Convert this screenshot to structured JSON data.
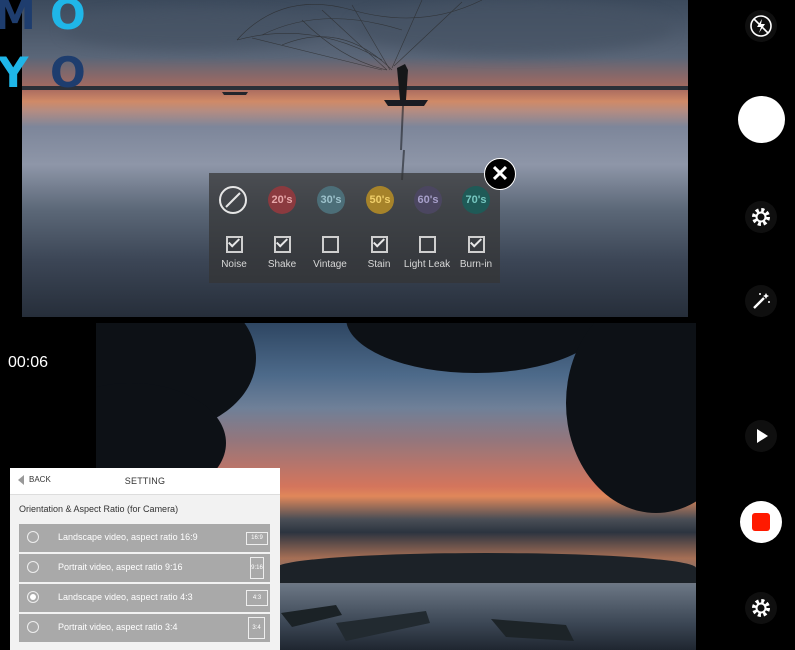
{
  "logo": {
    "letters": [
      "M",
      "O",
      "Y",
      "O"
    ]
  },
  "filters": {
    "eras": [
      {
        "label": "",
        "color": "#d9d9d9",
        "text_color": "#ffffff"
      },
      {
        "label": "20's",
        "color": "#8b3a3f",
        "text_color": "#e7a7a9"
      },
      {
        "label": "30's",
        "color": "#4c6e78",
        "text_color": "#9dc2cc"
      },
      {
        "label": "50's",
        "color": "#a6832a",
        "text_color": "#f0cf6a"
      },
      {
        "label": "60's",
        "color": "#4b4660",
        "text_color": "#a79fca"
      },
      {
        "label": "70's",
        "color": "#1f5a57",
        "text_color": "#76c7c0"
      }
    ],
    "checks": [
      {
        "label": "Noise",
        "checked": true
      },
      {
        "label": "Shake",
        "checked": true
      },
      {
        "label": "Vintage",
        "checked": false
      },
      {
        "label": "Stain",
        "checked": true
      },
      {
        "label": "Light Leak",
        "checked": false
      },
      {
        "label": "Burn-in",
        "checked": true
      }
    ],
    "close_symbol": "✕"
  },
  "timer": "00:06",
  "sidebar": {
    "icons": [
      "flash-off-icon",
      "shutter-button",
      "settings-icon",
      "magic-wand-icon",
      "play-icon",
      "record-button",
      "settings-icon"
    ]
  },
  "settings": {
    "back_label": "BACK",
    "title": "SETTING",
    "section_title": "Orientation & Aspect Ratio (for Camera)",
    "options": [
      {
        "label": "Landscape video, aspect ratio 16:9",
        "ratio": "16:9",
        "selected": false
      },
      {
        "label": "Portrait video, aspect ratio 9:16",
        "ratio": "9:16",
        "selected": false
      },
      {
        "label": "Landscape video, aspect ratio 4:3",
        "ratio": "4:3",
        "selected": true
      },
      {
        "label": "Portrait video, aspect ratio 3:4",
        "ratio": "3:4",
        "selected": false
      }
    ]
  },
  "colors": {
    "record": "#ff1a00",
    "logo_dark": "#1e3d6e",
    "logo_cyan": "#1fb6e8"
  }
}
